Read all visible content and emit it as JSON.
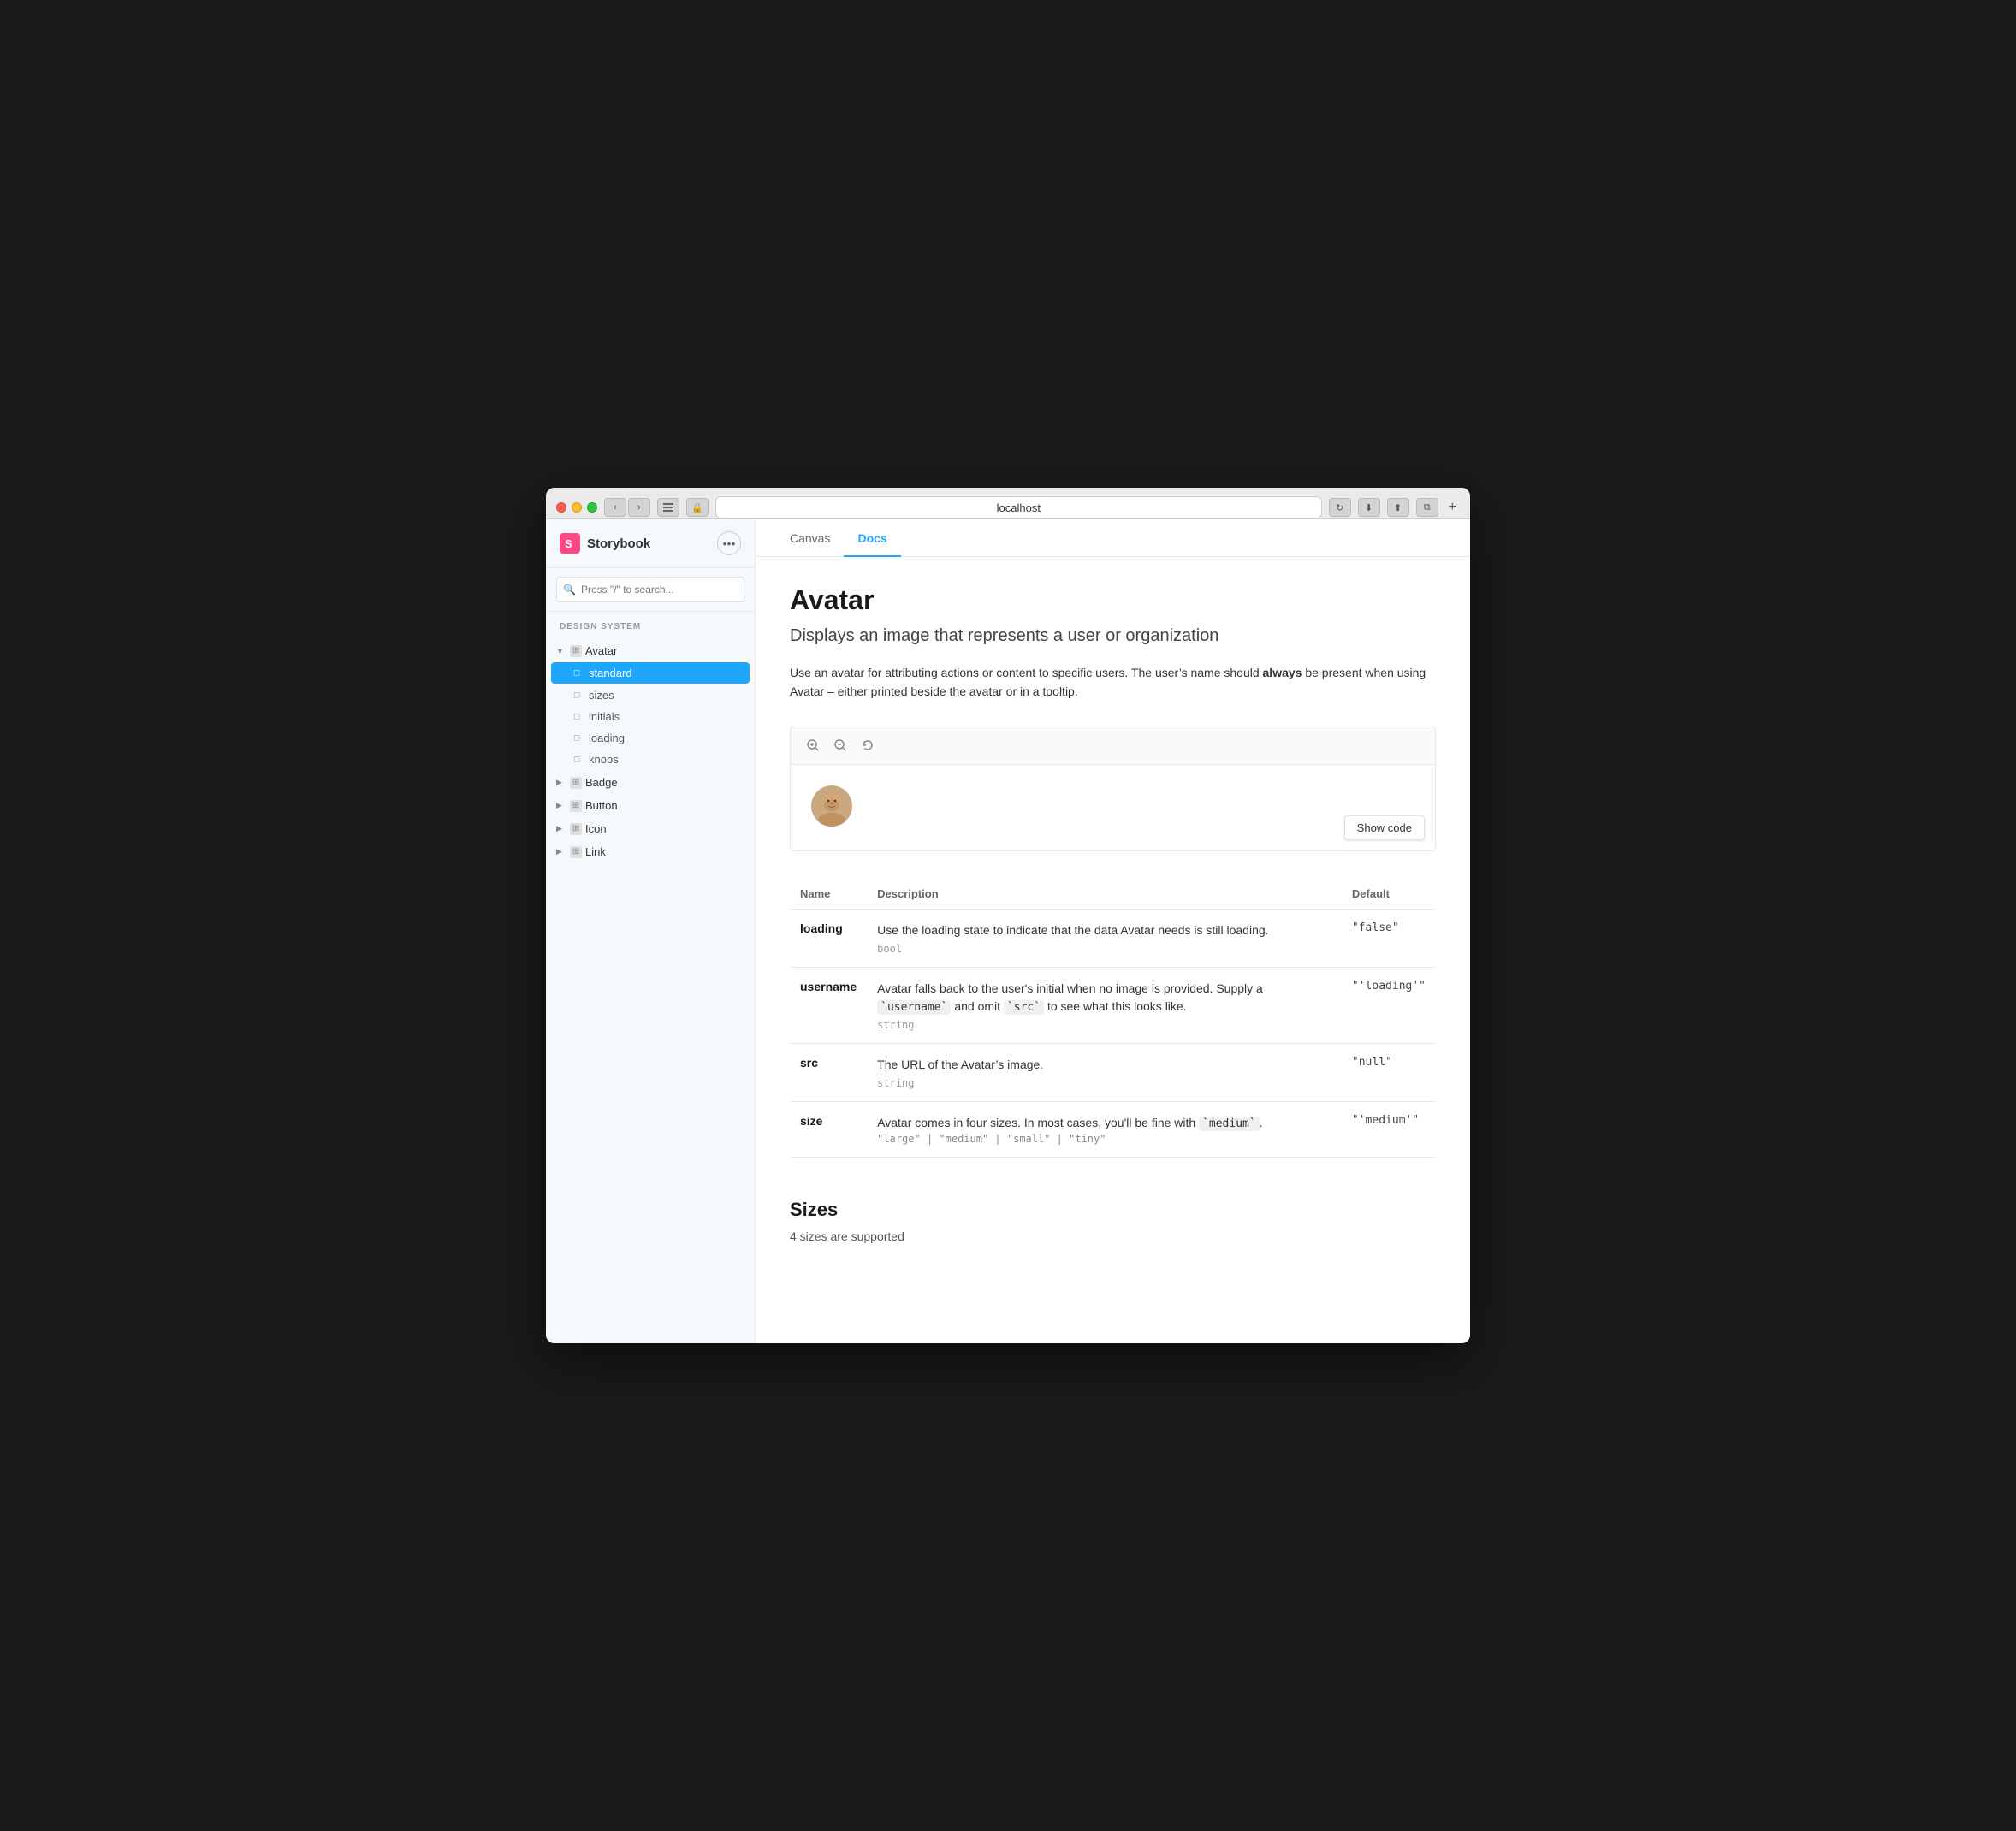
{
  "browser": {
    "url": "localhost",
    "tab_plus": "+"
  },
  "sidebar": {
    "logo_text": "Storybook",
    "more_label": "•••",
    "search_placeholder": "Press \"/\" to search...",
    "section_label": "Design System",
    "nav_items": [
      {
        "label": "Avatar",
        "expanded": true,
        "children": [
          {
            "label": "standard",
            "active": true
          },
          {
            "label": "sizes",
            "active": false
          },
          {
            "label": "initials",
            "active": false
          },
          {
            "label": "loading",
            "active": false
          },
          {
            "label": "knobs",
            "active": false
          }
        ]
      },
      {
        "label": "Badge",
        "expanded": false,
        "children": []
      },
      {
        "label": "Button",
        "expanded": false,
        "children": []
      },
      {
        "label": "Icon",
        "expanded": false,
        "children": []
      },
      {
        "label": "Link",
        "expanded": false,
        "children": []
      }
    ]
  },
  "tabs": [
    {
      "label": "Canvas",
      "active": false
    },
    {
      "label": "Docs",
      "active": true
    }
  ],
  "docs": {
    "title": "Avatar",
    "subtitle": "Displays an image that represents a user or organization",
    "description_plain": "Use an avatar for attributing actions or content to specific users. The user’s name should ",
    "description_bold": "always",
    "description_rest": " be present when using Avatar – either printed beside the avatar or in a tooltip.",
    "show_code_label": "Show code",
    "preview_tools": {
      "zoom_in": "＋",
      "zoom_out": "−",
      "reset": "↺"
    },
    "props_table": {
      "columns": [
        "Name",
        "Description",
        "Default"
      ],
      "rows": [
        {
          "name": "loading",
          "description": "Use the loading state to indicate that the data Avatar needs is still loading.",
          "type": "bool",
          "options": null,
          "default": "\"false\""
        },
        {
          "name": "username",
          "description": "Avatar falls back to the user’s initial when no image is provided. Supply a `username` and omit `src` to see what this looks like.",
          "type": "string",
          "options": null,
          "default": "\"'loading'\""
        },
        {
          "name": "src",
          "description": "The URL of the Avatar’s image.",
          "type": "string",
          "options": null,
          "default": "\"null\""
        },
        {
          "name": "size",
          "description": "Avatar comes in four sizes. In most cases, you’ll be fine with `medium`.",
          "type": null,
          "options": "\"large\" | \"medium\" | \"small\" | \"tiny\"",
          "default": "\"'medium'\""
        }
      ]
    },
    "sizes_section": {
      "heading": "Sizes",
      "sub": "4 sizes are supported"
    }
  }
}
